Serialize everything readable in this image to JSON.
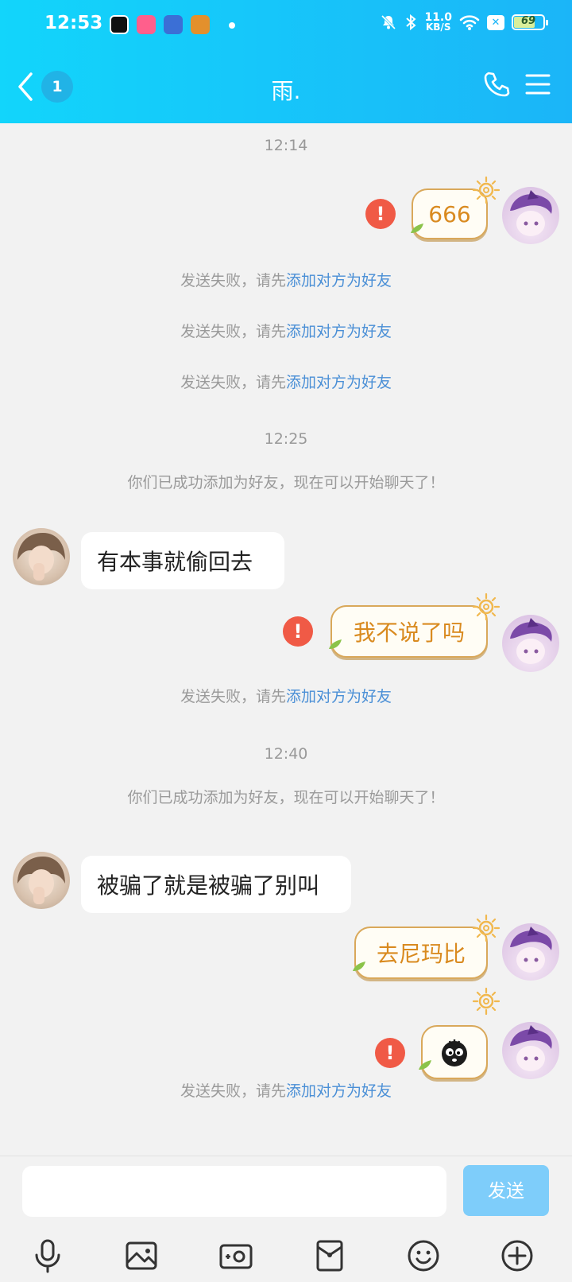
{
  "status": {
    "time": "12:53",
    "net_speed_value": "11.0",
    "net_speed_unit": "KB/S",
    "battery": "69",
    "battery_level": 0.69
  },
  "header": {
    "unread_count": "1",
    "title": "雨."
  },
  "messages": {
    "ts1": "12:14",
    "m1_text": "666",
    "fail_prefix": "发送失败，请先",
    "fail_link": "添加对方为好友",
    "ts2": "12:25",
    "friends_notice": "你们已成功添加为好友，现在可以开始聊天了！",
    "m2_text": "有本事就偷回去",
    "m3_text": "我不说了吗",
    "ts3": "12:40",
    "m4_text": "被骗了就是被骗了别叫",
    "m5_text": "去尼玛比"
  },
  "input": {
    "placeholder": "",
    "send_label": "发送"
  },
  "colors": {
    "header_start": "#12d5fb",
    "header_end": "#1bb5f8",
    "error": "#f05a46",
    "link": "#4a8fd6",
    "send_disabled": "#7ecdfa"
  }
}
